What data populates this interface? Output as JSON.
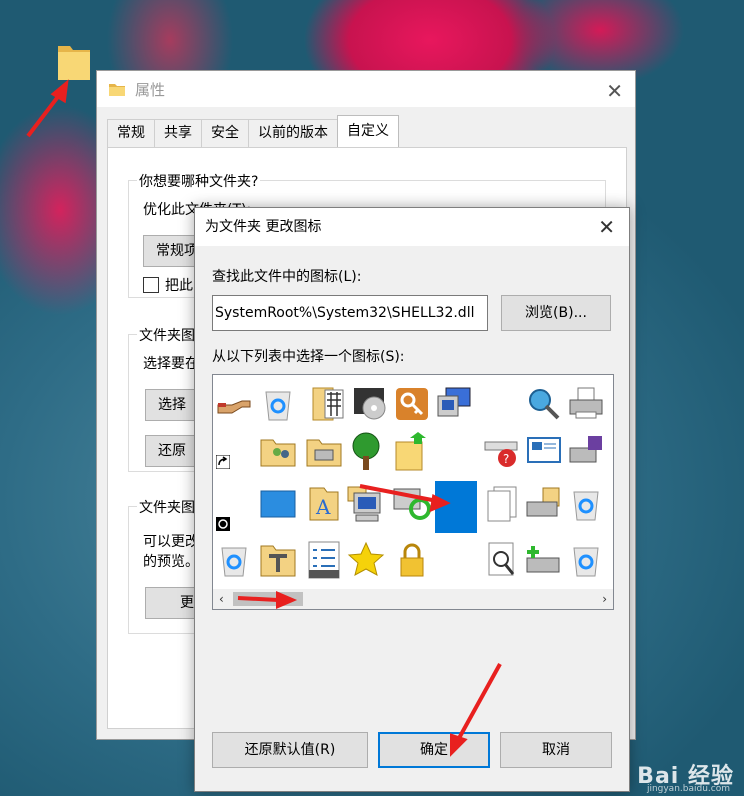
{
  "properties": {
    "title": "属性",
    "tabs": [
      "常规",
      "共享",
      "安全",
      "以前的版本",
      "自定义"
    ],
    "group1_label": "你想要哪种文件夹?",
    "optimize_label": "优化此文件夹(T):",
    "optimize_value": "常规项",
    "subfolder_checkbox": "把此",
    "group2_label": "文件夹图",
    "group2_desc": "选择要在",
    "choose_file_btn": "选择",
    "restore_btn": "还原",
    "group3_label": "文件夹图",
    "group3_desc_1": "可以更改",
    "group3_desc_2": "的预览。",
    "change_icon_btn": "更"
  },
  "dialog": {
    "title": "为文件夹 更改图标",
    "find_label": "查找此文件中的图标(L):",
    "path_value": "SystemRoot%\\System32\\SHELL32.dll",
    "browse_btn": "浏览(B)...",
    "list_label": "从以下列表中选择一个图标(S):",
    "restore_default_btn": "还原默认值(R)",
    "ok_btn": "确定",
    "cancel_btn": "取消"
  },
  "icons": [
    "hand-share",
    "recycle-bin",
    "folder-grid",
    "dvd-drive",
    "key",
    "computer-monitor",
    "search-globe",
    "printer",
    "shortcut-arrow",
    "folder-people",
    "folder-printer",
    "tree",
    "folder-up-arrow",
    "network-error",
    "desktop-screen",
    "printer-save",
    "clock-overlay",
    "blue-window",
    "folder-text",
    "computer-monitor-2",
    "network-sync",
    "selected-blank",
    "documents",
    "printer-folder",
    "recycle-bin-2",
    "recycle-bin-3",
    "folder-tools",
    "checklist",
    "star",
    "lock",
    "magnifier-doc",
    "printer-add",
    "recycle-bin-4"
  ],
  "watermark": "Bai 经验",
  "watermark_url": "jingyan.baidu.com"
}
